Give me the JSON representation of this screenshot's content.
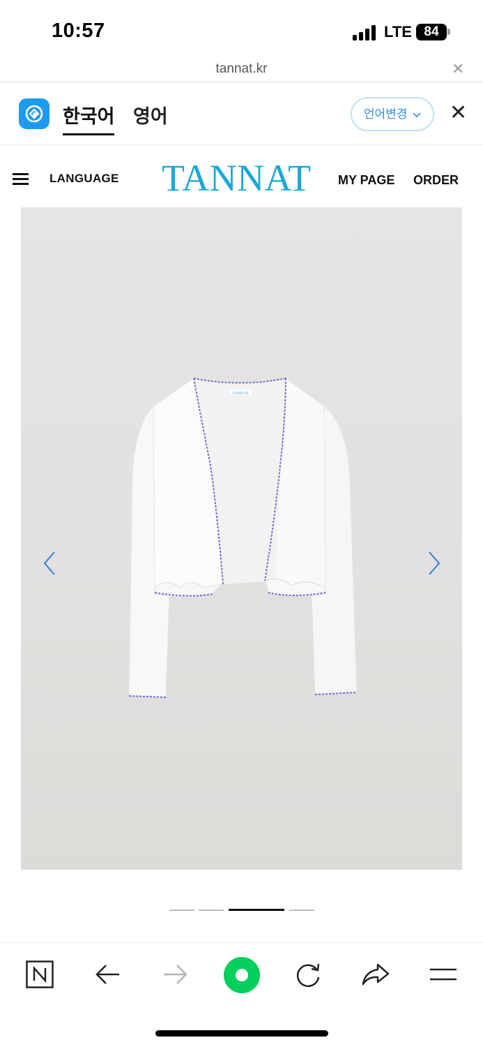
{
  "status_bar": {
    "time": "10:57",
    "network": "LTE",
    "battery": "84"
  },
  "browser": {
    "url": "tannat.kr"
  },
  "translate_bar": {
    "current_language": "한국어",
    "other_language": "영어",
    "change_language_label": "언어변경"
  },
  "site_header": {
    "language_label": "LANGUAGE",
    "logo": "TANNAT",
    "my_page_label": "MY PAGE",
    "order_label": "ORDER"
  },
  "product_gallery": {
    "slide_count": 4,
    "active_slide": 3,
    "image_description_icon": "white-cardigan-photo",
    "garment_label_text": "TANNAT"
  },
  "toolbar": {
    "items": [
      "naver-home-icon",
      "back-arrow-icon",
      "forward-arrow-icon",
      "green-dot-icon",
      "refresh-icon",
      "share-icon",
      "menu-icon"
    ]
  },
  "colors": {
    "brand": "#17a8d9",
    "accent_blue": "#2f8ee0",
    "naver_green": "#03cf5d"
  }
}
